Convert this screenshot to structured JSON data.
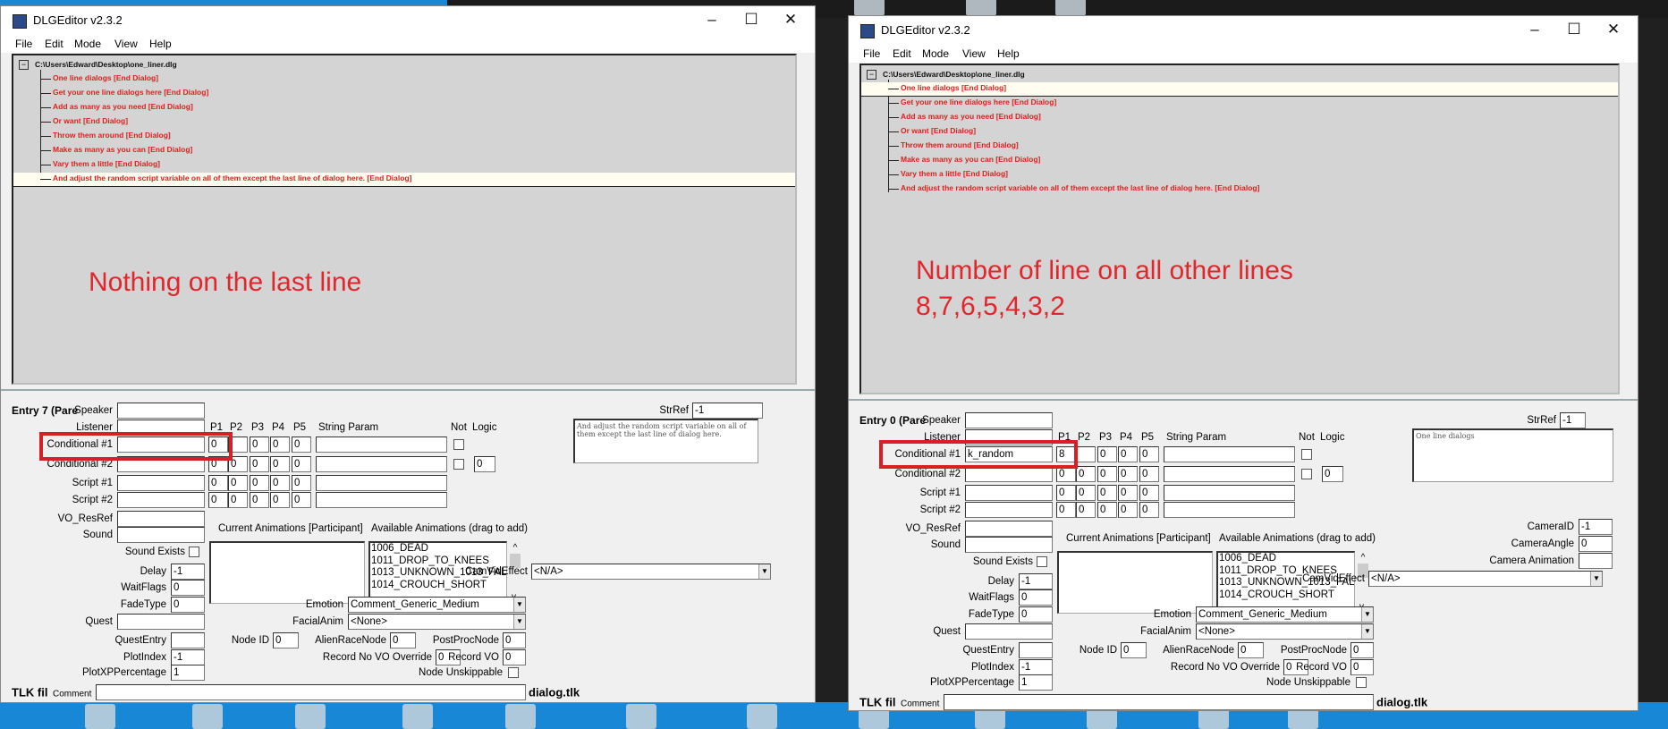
{
  "labels": {
    "speaker": "Speaker",
    "listener": "Listener",
    "conditional1": "Conditional #1",
    "conditional2": "Conditional #2",
    "script1": "Script #1",
    "script2": "Script #2",
    "vo_resref": "VO_ResRef",
    "sound": "Sound",
    "sound_exists": "Sound Exists",
    "delay": "Delay",
    "wait_flags": "WaitFlags",
    "fade_type": "FadeType",
    "quest": "Quest",
    "quest_entry": "QuestEntry",
    "plot_index": "PlotIndex",
    "plot_xp": "PlotXPPercentage",
    "tlk": "TLK fil",
    "comment": "Comment",
    "tlk_file": "dialog.tlk",
    "params": [
      "P1",
      "P2",
      "P3",
      "P4",
      "P5"
    ],
    "string_param": "String Param",
    "not": "Not",
    "logic": "Logic",
    "strref": "StrRef",
    "current_anims": "Current Animations [Participant]",
    "available_anims": "Available Animations (drag to add)",
    "cam_vid_effect": "CamVidEffect",
    "camera_id": "CameraID",
    "camera_angle": "CameraAngle",
    "camera_animation": "Camera Animation",
    "emotion": "Emotion",
    "facial_anim": "FacialAnim",
    "node_id": "Node ID",
    "alien_race_node": "AlienRaceNode",
    "post_proc_node": "PostProcNode",
    "record_no_vo": "Record No VO Override",
    "record_vo": "Record VO",
    "node_unskippable": "Node Unskippable"
  },
  "available_animations": [
    "1006_DEAD",
    "1011_DROP_TO_KNEES",
    "1013_UNKNOWN_1013_FALL",
    "1014_CROUCH_SHORT"
  ],
  "colors": {
    "annotation": "#e2262b",
    "tree_text": "#e01e1e",
    "highlight_box": "#d91f26"
  },
  "windows": [
    {
      "title": "DLGEditor v2.3.2",
      "controls": {
        "minimize": "–",
        "maximize": "☐",
        "close": "✕"
      },
      "menu": [
        "File",
        "Edit",
        "Mode",
        "View",
        "Help"
      ],
      "tree": {
        "root": "C:\\Users\\Edward\\Desktop\\one_liner.dlg",
        "items": [
          "One line dialogs [End Dialog]",
          "Get your one line dialogs here [End Dialog]",
          "Add as many as you need [End Dialog]",
          "Or want [End Dialog]",
          "Throw them around [End Dialog]",
          "Make as many as you can [End Dialog]",
          "Vary them a little [End Dialog]",
          "And adjust the random script variable on all of them except the last line of dialog here. [End Dialog]"
        ],
        "selected_index": 7
      },
      "annotation": [
        "Nothing on the last line"
      ],
      "entry_label": "Entry 7 (Pare",
      "show_camera_fields": false,
      "form": {
        "speaker": "",
        "listener": "",
        "conditional1": "",
        "conditional2": "",
        "script1": "",
        "script2": "",
        "vo_resref": "",
        "sound": "",
        "cond1_params": [
          "0",
          "",
          "0",
          "0",
          "0"
        ],
        "cond2_params": [
          "0",
          "0",
          "0",
          "0",
          "0"
        ],
        "script1_params": [
          "0",
          "0",
          "0",
          "0",
          "0"
        ],
        "script2_params": [
          "0",
          "0",
          "0",
          "0",
          "0"
        ],
        "logic": "0",
        "strref": "-1",
        "text": "And adjust the random script variable on all of them except the last line of dialog here.",
        "delay": "-1",
        "wait_flags": "0",
        "fade_type": "0",
        "quest": "",
        "quest_entry": "",
        "plot_index": "-1",
        "plot_xp": "1",
        "emotion": "Comment_Generic_Medium",
        "facial_anim": "<None>",
        "node_id": "0",
        "alien_race_node": "0",
        "post_proc_node": "0",
        "record_no_vo": "0",
        "record_vo": "0",
        "cam_vid_effect": "<N/A>",
        "comment": ""
      }
    },
    {
      "title": "DLGEditor v2.3.2",
      "controls": {
        "minimize": "–",
        "maximize": "☐",
        "close": "✕"
      },
      "menu": [
        "File",
        "Edit",
        "Mode",
        "View",
        "Help"
      ],
      "tree": {
        "root": "C:\\Users\\Edward\\Desktop\\one_liner.dlg",
        "items": [
          "One line dialogs [End Dialog]",
          "Get your one line dialogs here [End Dialog]",
          "Add as many as you need [End Dialog]",
          "Or want [End Dialog]",
          "Throw them around [End Dialog]",
          "Make as many as you can [End Dialog]",
          "Vary them a little [End Dialog]",
          "And adjust the random script variable on all of them except the last line of dialog here. [End Dialog]"
        ],
        "selected_index": 0
      },
      "annotation": [
        "Number of line on all other lines",
        "8,7,6,5,4,3,2"
      ],
      "entry_label": "Entry 0 (Pare",
      "show_camera_fields": true,
      "form": {
        "speaker": "",
        "listener": "",
        "conditional1": "k_random",
        "conditional2": "",
        "script1": "",
        "script2": "",
        "vo_resref": "",
        "sound": "",
        "cond1_params": [
          "8",
          "",
          "0",
          "0",
          "0"
        ],
        "cond2_params": [
          "0",
          "0",
          "0",
          "0",
          "0"
        ],
        "script1_params": [
          "0",
          "0",
          "0",
          "0",
          "0"
        ],
        "script2_params": [
          "0",
          "0",
          "0",
          "0",
          "0"
        ],
        "logic": "0",
        "strref": "-1",
        "text": "One line dialogs",
        "camera_id": "-1",
        "camera_angle": "0",
        "camera_animation": "",
        "delay": "-1",
        "wait_flags": "0",
        "fade_type": "0",
        "quest": "",
        "quest_entry": "",
        "plot_index": "-1",
        "plot_xp": "1",
        "emotion": "Comment_Generic_Medium",
        "facial_anim": "<None>",
        "node_id": "0",
        "alien_race_node": "0",
        "post_proc_node": "0",
        "record_no_vo": "0",
        "record_vo": "0",
        "cam_vid_effect": "<N/A>",
        "comment": ""
      }
    }
  ]
}
